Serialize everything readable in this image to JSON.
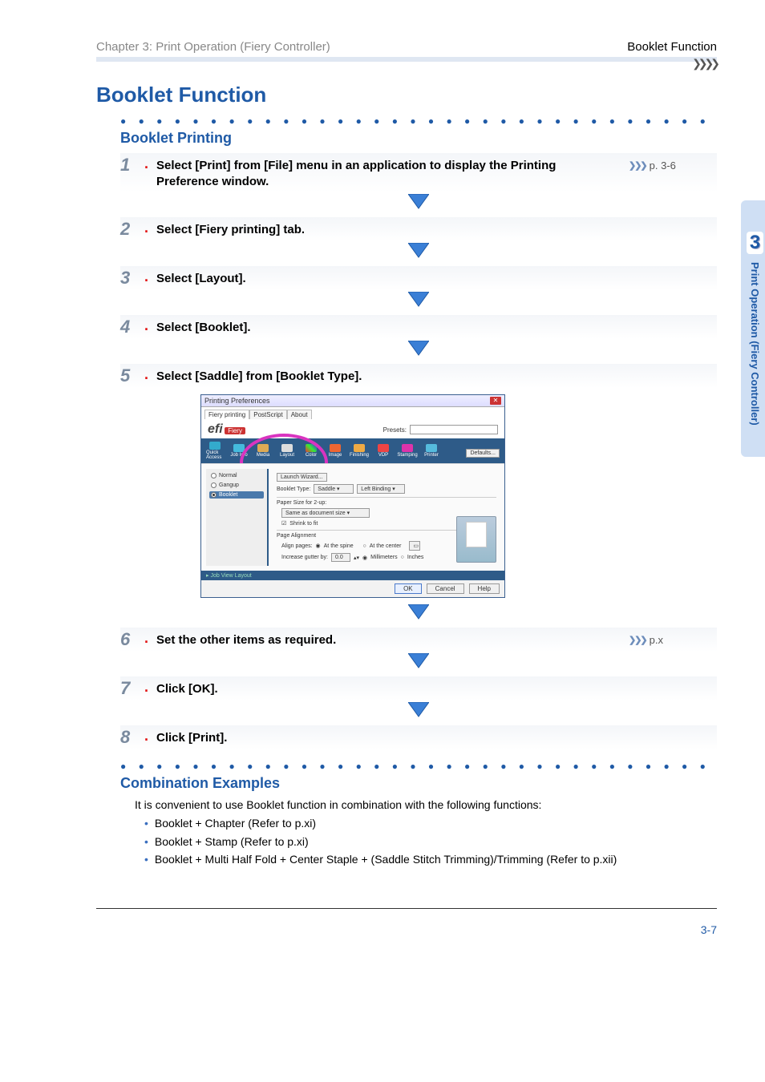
{
  "header": {
    "left": "Chapter 3: Print Operation (Fiery Controller)",
    "right": "Booklet Function"
  },
  "side_tab": {
    "chapter_number": "3",
    "label": "Print Operation (Fiery Controller)"
  },
  "page_title": "Booklet Function",
  "section1": {
    "title": "Booklet Printing",
    "steps": [
      {
        "num": "1",
        "text": "Select [Print] from [File] menu in an application to display the Printing Preference window.",
        "ref": "p. 3-6"
      },
      {
        "num": "2",
        "text": "Select [Fiery printing] tab."
      },
      {
        "num": "3",
        "text": "Select [Layout]."
      },
      {
        "num": "4",
        "text": "Select [Booklet]."
      },
      {
        "num": "5",
        "text": "Select [Saddle] from [Booklet Type]."
      },
      {
        "num": "6",
        "text": "Set the other items as required.",
        "ref": "p.x"
      },
      {
        "num": "7",
        "text": "Click [OK]."
      },
      {
        "num": "8",
        "text": "Click [Print]."
      }
    ]
  },
  "screenshot": {
    "window_title": "Printing Preferences",
    "tabs": [
      "Fiery printing",
      "PostScript",
      "About"
    ],
    "brand": "efi",
    "brand_badge": "Fiery",
    "presets_label": "Presets:",
    "iconbar": [
      "Quick Access",
      "Job Info",
      "Media",
      "Layout",
      "Color",
      "Image",
      "Finishing",
      "VDP",
      "Stamping",
      "Printer"
    ],
    "defaults_btn": "Defaults...",
    "left_radios": [
      {
        "label": "Normal",
        "selected": false
      },
      {
        "label": "Gangup",
        "selected": false
      },
      {
        "label": "Booklet",
        "selected": true
      }
    ],
    "right_panel": {
      "launch_wizard": "Launch Wizard...",
      "booklet_type_label": "Booklet Type:",
      "booklet_type_value": "Saddle",
      "binding_value": "Left Binding",
      "paper_size_label": "Paper Size for 2-up:",
      "paper_size_value": "Same as document size",
      "shrink_label": "Shrink to fit",
      "page_align_label": "Page Alignment",
      "align_pages_label": "Align pages:",
      "align_spine": "At the spine",
      "align_center": "At the center",
      "gutter_label": "Increase gutter by:",
      "gutter_val": "0.0",
      "gutter_mm": "Millimeters",
      "gutter_in": "Inches"
    },
    "strip": "▸ Job View Layout",
    "buttons": {
      "ok": "OK",
      "cancel": "Cancel",
      "help": "Help"
    }
  },
  "section2": {
    "title": "Combination Examples",
    "intro": "It is convenient to use Booklet function in combination with the following functions:",
    "items": [
      "Booklet + Chapter (Refer to p.xi)",
      "Booklet + Stamp (Refer to p.xi)",
      "Booklet + Multi Half Fold + Center Staple + (Saddle Stitch Trimming)/Trimming (Refer to p.xii)"
    ]
  },
  "footer": {
    "page": "3-7"
  }
}
